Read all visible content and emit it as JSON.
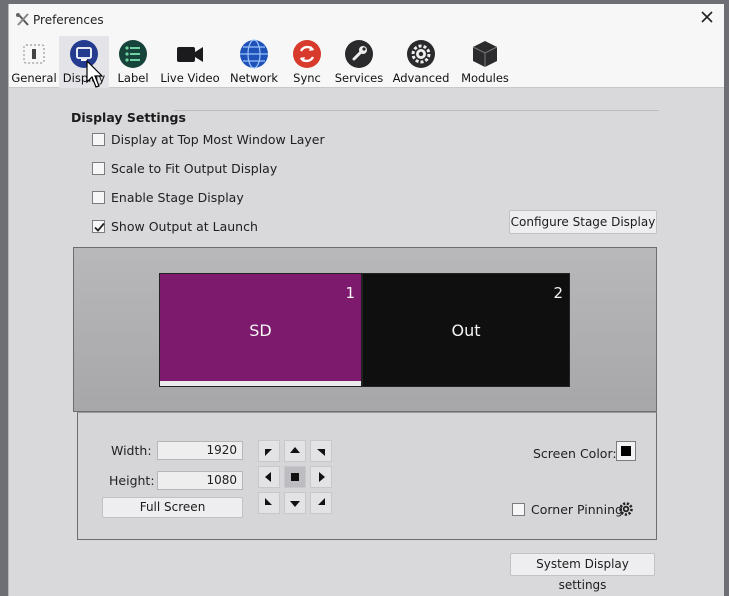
{
  "window": {
    "title": "Preferences"
  },
  "toolbar": {
    "items": [
      {
        "label": "General",
        "icon": "general-icon"
      },
      {
        "label": "Display",
        "icon": "display-icon",
        "selected": true
      },
      {
        "label": "Label",
        "icon": "label-icon"
      },
      {
        "label": "Live Video",
        "icon": "video-camera-icon"
      },
      {
        "label": "Network",
        "icon": "globe-icon"
      },
      {
        "label": "Sync",
        "icon": "sync-icon"
      },
      {
        "label": "Services",
        "icon": "wrench-icon"
      },
      {
        "label": "Advanced",
        "icon": "gear-icon"
      },
      {
        "label": "Modules",
        "icon": "cube-icon"
      }
    ]
  },
  "display_settings": {
    "title": "Display Settings",
    "options": [
      {
        "label": "Display at Top Most Window Layer",
        "checked": false
      },
      {
        "label": "Scale to Fit Output Display",
        "checked": false
      },
      {
        "label": "Enable Stage Display",
        "checked": false
      },
      {
        "label": "Show Output at Launch",
        "checked": true
      }
    ],
    "configure_button": "Configure Stage Display"
  },
  "screens": [
    {
      "number": "1",
      "name": "SD",
      "color": "#7d1a6e"
    },
    {
      "number": "2",
      "name": "Out",
      "color": "#0f0f10"
    }
  ],
  "controls": {
    "width_label": "Width:",
    "width_value": "1920",
    "height_label": "Height:",
    "height_value": "1080",
    "full_screen_button": "Full Screen",
    "screen_color_label": "Screen Color:",
    "screen_color": "#000000",
    "corner_pinning_label": "Corner Pinning",
    "corner_pinning_checked": false
  },
  "footer": {
    "system_display_button": "System Display settings"
  }
}
